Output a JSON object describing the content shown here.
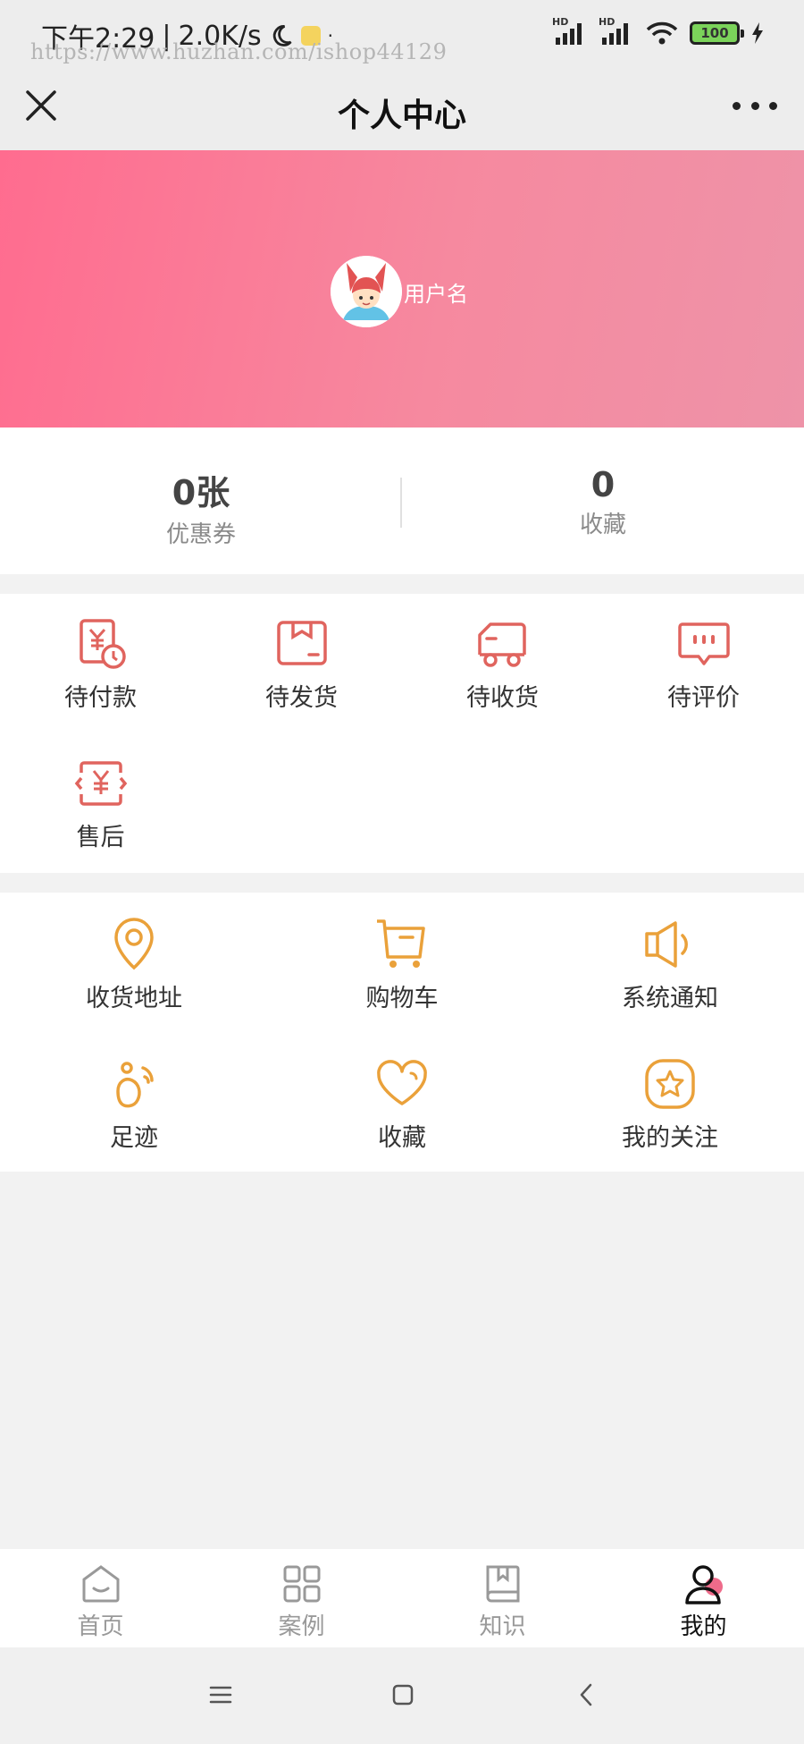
{
  "status_bar": {
    "time": "下午2:29",
    "speed": "2.0K/s",
    "watermark": "https://www.huzhan.com/ishop44129",
    "network_1": "HD",
    "network_2": "HD",
    "battery": "100"
  },
  "header": {
    "title": "个人中心",
    "close_icon": "close-icon",
    "more_icon": "more-icon"
  },
  "profile": {
    "username": "用户名"
  },
  "stats": [
    {
      "value": "0张",
      "label": "优惠券"
    },
    {
      "value": "0",
      "label": "收藏"
    }
  ],
  "orders": [
    {
      "label": "待付款",
      "icon": "pending-payment-icon"
    },
    {
      "label": "待发货",
      "icon": "pending-shipment-icon"
    },
    {
      "label": "待收货",
      "icon": "pending-receipt-icon"
    },
    {
      "label": "待评价",
      "icon": "pending-review-icon"
    },
    {
      "label": "售后",
      "icon": "after-sales-icon"
    }
  ],
  "services": [
    {
      "label": "收货地址",
      "icon": "location-icon"
    },
    {
      "label": "购物车",
      "icon": "cart-icon"
    },
    {
      "label": "系统通知",
      "icon": "speaker-icon"
    },
    {
      "label": "足迹",
      "icon": "footprint-icon"
    },
    {
      "label": "收藏",
      "icon": "heart-icon"
    },
    {
      "label": "我的关注",
      "icon": "star-icon"
    }
  ],
  "tabs": [
    {
      "label": "首页",
      "icon": "home-icon",
      "active": false
    },
    {
      "label": "案例",
      "icon": "grid-icon",
      "active": false
    },
    {
      "label": "知识",
      "icon": "book-icon",
      "active": false
    },
    {
      "label": "我的",
      "icon": "user-icon",
      "active": true
    }
  ],
  "colors": {
    "order_icon": "#e0645e",
    "service_icon": "#eaa13a",
    "banner_start": "#ff6c8f",
    "banner_end": "#ee93a8"
  }
}
